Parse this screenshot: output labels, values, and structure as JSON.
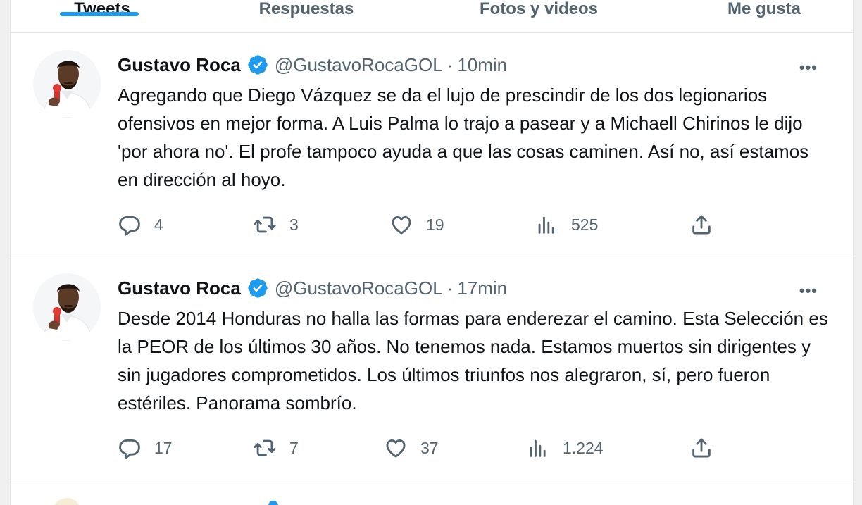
{
  "tabs": [
    {
      "label": "Tweets"
    },
    {
      "label": "Respuestas"
    },
    {
      "label": "Fotos y videos"
    },
    {
      "label": "Me gusta"
    }
  ],
  "colors": {
    "accent": "#1d9bf0",
    "text": "#0f1419",
    "muted": "#536471"
  },
  "tweets": [
    {
      "author": "Gustavo Roca",
      "handle": "@GustavoRocaGOL",
      "separator": "·",
      "time": "10min",
      "text": "Agregando que Diego Vázquez se da el lujo de prescindir de los dos legionarios ofensivos en mejor forma. A Luis Palma lo trajo a pasear y a Michaell Chirinos le dijo 'por ahora no'. El profe tampoco ayuda a que las cosas caminen. Así no, así estamos en dirección al hoyo.",
      "replies": "4",
      "retweets": "3",
      "likes": "19",
      "views": "525"
    },
    {
      "author": "Gustavo Roca",
      "handle": "@GustavoRocaGOL",
      "separator": "·",
      "time": "17min",
      "text": "Desde 2014 Honduras no halla las formas para enderezar el camino. Esta Selección es la PEOR de los últimos 30 años. No tenemos nada. Estamos muertos sin dirigentes y sin jugadores comprometidos. Los últimos triunfos nos alegraron, sí, pero fueron estériles. Panorama sombrío.",
      "replies": "17",
      "retweets": "7",
      "likes": "37",
      "views": "1.224"
    }
  ],
  "icons": {
    "more": "more-icon",
    "reply": "reply-icon",
    "retweet": "retweet-icon",
    "like": "heart-icon",
    "views": "views-icon",
    "share": "share-icon",
    "verified": "verified-badge-icon"
  },
  "glyphs": {
    "more": "•••"
  }
}
